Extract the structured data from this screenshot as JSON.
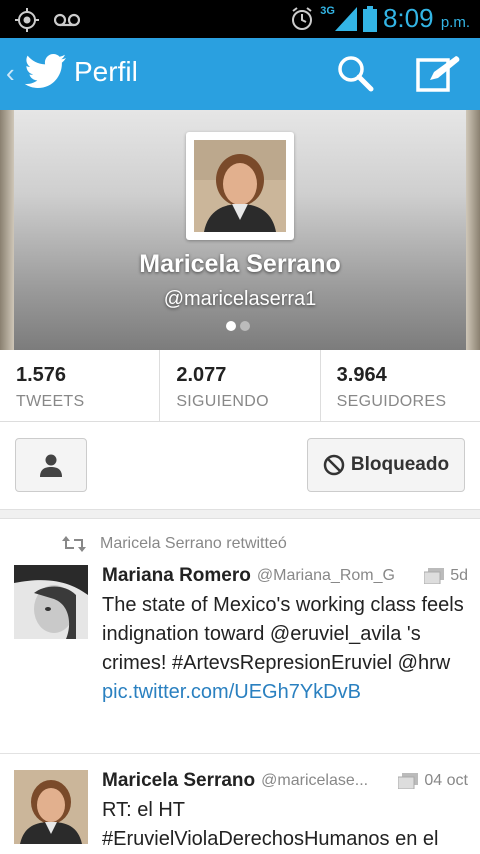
{
  "statusbar": {
    "time": "8:09",
    "ampm": "p.m.",
    "network": "3G"
  },
  "actionbar": {
    "title": "Perfil"
  },
  "profile": {
    "name": "Maricela Serrano",
    "handle": "@maricelaserra1"
  },
  "stats": [
    {
      "value": "1.576",
      "label": "TWEETS"
    },
    {
      "value": "2.077",
      "label": "SIGUIENDO"
    },
    {
      "value": "3.964",
      "label": "SEGUIDORES"
    }
  ],
  "actions": {
    "block_label": "Bloqueado"
  },
  "tweets": [
    {
      "retweet_by": "Maricela Serrano retwitteó",
      "name": "Mariana Romero",
      "user": "@Mariana_Rom_G",
      "time": "5d",
      "text": "The state of Mexico's working class feels indignation toward @eruviel_avila 's crimes! #ArtevsRepresionEruviel @hrw ",
      "link": "pic.twitter.com/UEGh7YkDvB"
    },
    {
      "name": "Maricela Serrano",
      "user": "@maricelase...",
      "time": "04 oct",
      "text": "RT: el HT #EruvielViolaDerechosHumanos en el"
    }
  ],
  "icons": [
    "location-icon",
    "voicemail-icon",
    "alarm-icon",
    "signal-icon",
    "battery-icon",
    "back-icon",
    "twitter-bird-icon",
    "search-icon",
    "compose-icon",
    "follow-person-icon",
    "block-icon",
    "retweet-icon",
    "media-icon"
  ],
  "colors": {
    "accent": "#2aa0e0",
    "status_blue": "#33b5e5",
    "link": "#2a80c0"
  }
}
